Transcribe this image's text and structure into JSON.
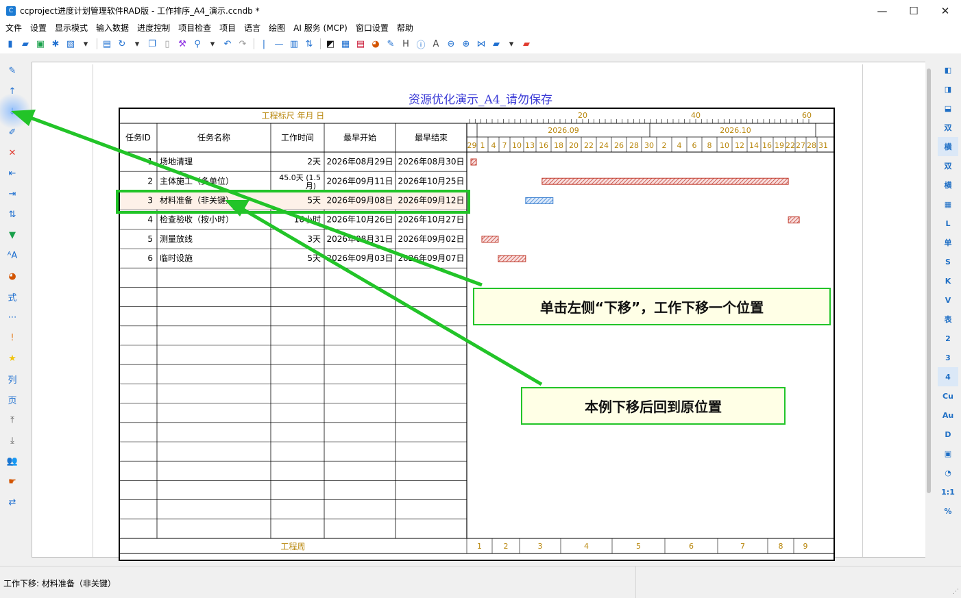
{
  "window": {
    "title": "ccproject进度计划管理软件RAD版 - 工作排序_A4_演示.ccndb *",
    "app_icon": "C",
    "minimize_glyph": "—",
    "maximize_glyph": "☐",
    "close_glyph": "✕"
  },
  "menu": [
    "文件",
    "设置",
    "显示模式",
    "输入数据",
    "进度控制",
    "项目检查",
    "项目",
    "语言",
    "绘图",
    "AI 服务 (MCP)",
    "窗口设置",
    "帮助"
  ],
  "toolbar": [
    {
      "icon": "new-icon",
      "glyph": "▮",
      "color": "#1e6fd0"
    },
    {
      "icon": "open-icon",
      "glyph": "▰",
      "color": "#1e6fd0"
    },
    {
      "icon": "save-icon",
      "glyph": "▣",
      "color": "#18a04a"
    },
    {
      "icon": "asterisk-icon",
      "glyph": "✱",
      "color": "#1e6fd0"
    },
    {
      "icon": "image-icon",
      "glyph": "▧",
      "color": "#1e6fd0"
    },
    {
      "icon": "dropdown-icon",
      "glyph": "▾",
      "color": "#333"
    },
    {
      "icon": "print-icon",
      "glyph": "▤",
      "color": "#1e6fd0"
    },
    {
      "icon": "refresh-icon",
      "glyph": "↻",
      "color": "#1e6fd0"
    },
    {
      "icon": "dropdown-icon",
      "glyph": "▾",
      "color": "#333"
    },
    {
      "icon": "copy-icon",
      "glyph": "❐",
      "color": "#1e6fd0"
    },
    {
      "icon": "paste-icon",
      "glyph": "▯",
      "color": "#999"
    },
    {
      "icon": "format-painter-icon",
      "glyph": "⚒",
      "color": "#8a2be2"
    },
    {
      "icon": "search-icon",
      "glyph": "⚲",
      "color": "#1e6fd0"
    },
    {
      "icon": "dropdown-icon",
      "glyph": "▾",
      "color": "#333"
    },
    {
      "icon": "undo-icon",
      "glyph": "↶",
      "color": "#1e6fd0"
    },
    {
      "icon": "redo-icon",
      "glyph": "↷",
      "color": "#999"
    },
    {
      "icon": "vertical-line-icon",
      "glyph": "|",
      "color": "#1e6fd0"
    },
    {
      "icon": "horizontal-line-icon",
      "glyph": "—",
      "color": "#1e6fd0"
    },
    {
      "icon": "columns-icon",
      "glyph": "▥",
      "color": "#1e6fd0"
    },
    {
      "icon": "sort-icon",
      "glyph": "⇅",
      "color": "#1e6fd0"
    },
    {
      "icon": "network-icon",
      "glyph": "◩",
      "color": "#111"
    },
    {
      "icon": "chart-icon",
      "glyph": "▦",
      "color": "#1e6fd0"
    },
    {
      "icon": "report-icon",
      "glyph": "▤",
      "color": "#c8102e"
    },
    {
      "icon": "palette-icon",
      "glyph": "◕",
      "color": "#d35400"
    },
    {
      "icon": "edit-icon",
      "glyph": "✎",
      "color": "#1e6fd0"
    },
    {
      "icon": "h-icon",
      "glyph": "H",
      "color": "#444"
    },
    {
      "icon": "info-icon",
      "glyph": "ⓘ",
      "color": "#1e6fd0"
    },
    {
      "icon": "font-icon",
      "glyph": "A",
      "color": "#444"
    },
    {
      "icon": "zoom-out-icon",
      "glyph": "⊖",
      "color": "#1e6fd0"
    },
    {
      "icon": "zoom-in-icon",
      "glyph": "⊕",
      "color": "#1e6fd0"
    },
    {
      "icon": "collapse-icon",
      "glyph": "⋈",
      "color": "#1e6fd0"
    },
    {
      "icon": "folder-icon",
      "glyph": "▰",
      "color": "#1e6fd0"
    },
    {
      "icon": "dropdown-icon",
      "glyph": "▾",
      "color": "#333"
    },
    {
      "icon": "briefcase-icon",
      "glyph": "▰",
      "color": "#e03a2f"
    }
  ],
  "left_tools": [
    {
      "icon": "pencil-icon",
      "glyph": "✎",
      "color": "#1e6fd0"
    },
    {
      "icon": "move-up-icon",
      "glyph": "↑",
      "color": "#1e6fd0"
    },
    {
      "icon": "move-down-icon",
      "glyph": "↓",
      "color": "#1e6fd0"
    },
    {
      "icon": "edit-icon",
      "glyph": "✐",
      "color": "#1e6fd0"
    },
    {
      "icon": "delete-icon",
      "glyph": "✕",
      "color": "#e03a2f"
    },
    {
      "icon": "indent-left-icon",
      "glyph": "⇤",
      "color": "#1e6fd0"
    },
    {
      "icon": "indent-right-icon",
      "glyph": "⇥",
      "color": "#1e6fd0"
    },
    {
      "icon": "sort-icon",
      "glyph": "⇅",
      "color": "#1e6fd0"
    },
    {
      "icon": "filter-icon",
      "glyph": "▼",
      "color": "#18a04a"
    },
    {
      "icon": "font-size-icon",
      "glyph": "ᴬA",
      "color": "#1e6fd0"
    },
    {
      "icon": "palette-icon",
      "glyph": "◕",
      "color": "#d35400"
    },
    {
      "icon": "formula-icon",
      "glyph": "式",
      "color": "#1e6fd0"
    },
    {
      "icon": "dots-icon",
      "glyph": "⋯",
      "color": "#1e6fd0"
    },
    {
      "icon": "alert-icon",
      "glyph": "!",
      "color": "#e67e22"
    },
    {
      "icon": "star-icon",
      "glyph": "★",
      "color": "#f1c40f"
    },
    {
      "icon": "column-icon",
      "glyph": "列",
      "color": "#1e6fd0"
    },
    {
      "icon": "page-icon",
      "glyph": "页",
      "color": "#1e6fd0"
    },
    {
      "icon": "upload-icon",
      "glyph": "⤒",
      "color": "#555"
    },
    {
      "icon": "download-icon",
      "glyph": "⤓",
      "color": "#555"
    },
    {
      "icon": "users-icon",
      "glyph": "👥",
      "color": "#18a04a"
    },
    {
      "icon": "hand-icon",
      "glyph": "☛",
      "color": "#d35400"
    },
    {
      "icon": "swap-icon",
      "glyph": "⇄",
      "color": "#1e6fd0"
    }
  ],
  "right_tools": [
    {
      "icon": "panel-left-icon",
      "label": "◧",
      "selected": false
    },
    {
      "icon": "panel-right-icon",
      "label": "◨",
      "selected": false
    },
    {
      "icon": "panel-bottom-icon",
      "label": "⬓",
      "selected": false
    },
    {
      "icon": "double-icon",
      "label": "双",
      "selected": false
    },
    {
      "icon": "horizontal-icon",
      "label": "横",
      "selected": true
    },
    {
      "icon": "double-network-icon",
      "label": "双",
      "selected": false
    },
    {
      "icon": "horizontal-network-icon",
      "label": "横",
      "selected": false
    },
    {
      "icon": "table-icon",
      "label": "▦",
      "selected": false
    },
    {
      "icon": "l-icon",
      "label": "L",
      "selected": false
    },
    {
      "icon": "single-icon",
      "label": "单",
      "selected": false
    },
    {
      "icon": "s-icon",
      "label": "S",
      "selected": false
    },
    {
      "icon": "k-icon",
      "label": "K",
      "selected": false
    },
    {
      "icon": "v-icon",
      "label": "V",
      "selected": false
    },
    {
      "icon": "table-text-icon",
      "label": "表",
      "selected": false
    },
    {
      "icon": "num-2-icon",
      "label": "2",
      "selected": false
    },
    {
      "icon": "num-3-icon",
      "label": "3",
      "selected": false
    },
    {
      "icon": "num-4-icon",
      "label": "4",
      "selected": true
    },
    {
      "icon": "cu-icon",
      "label": "Cu",
      "selected": false
    },
    {
      "icon": "au-icon",
      "label": "Au",
      "selected": false
    },
    {
      "icon": "d-icon",
      "label": "D",
      "selected": false
    },
    {
      "icon": "calendar-icon",
      "label": "▣",
      "selected": false
    },
    {
      "icon": "comment-icon",
      "label": "◔",
      "selected": false
    },
    {
      "icon": "ratio-icon",
      "label": "1:1",
      "selected": false
    },
    {
      "icon": "percent-icon",
      "label": "%",
      "selected": false
    }
  ],
  "document": {
    "title": "资源优化演示_A4_请勿保存",
    "ruler_label": "工程标尺 年月 日",
    "ruler_ticks": [
      "20",
      "40",
      "60"
    ],
    "months": [
      "2026.09",
      "2026.10"
    ],
    "days": [
      "29",
      "1",
      "4",
      "7",
      "10",
      "13",
      "16",
      "18",
      "20",
      "22",
      "24",
      "26",
      "28",
      "30",
      "2",
      "4",
      "6",
      "8",
      "10",
      "12",
      "14",
      "16",
      "19",
      "22",
      "27",
      "28",
      "31"
    ],
    "columns": [
      "任务ID",
      "任务名称",
      "工作时间",
      "最早开始",
      "最早结束"
    ],
    "rows": [
      {
        "id": "1",
        "name": "场地清理",
        "duration": "2天",
        "duration_sub": "",
        "start": "2026年08月29日",
        "end": "2026年08月30日",
        "bar_start": 0,
        "bar_end": 1,
        "critical": true
      },
      {
        "id": "2",
        "name": "主体施工（多单位）",
        "duration": "45.0天 (1.5",
        "duration_sub": "月)",
        "start": "2026年09月11日",
        "end": "2026年10月25日",
        "bar_start": 13,
        "bar_end": 58,
        "critical": true
      },
      {
        "id": "3",
        "name": "材料准备（非关键）",
        "duration": "5天",
        "duration_sub": "",
        "start": "2026年09月08日",
        "end": "2026年09月12日",
        "bar_start": 10,
        "bar_end": 15,
        "critical": false
      },
      {
        "id": "4",
        "name": "检查验收（按小时）",
        "duration": "16小时",
        "duration_sub": "",
        "start": "2026年10月26日",
        "end": "2026年10月27日",
        "bar_start": 58,
        "bar_end": 60,
        "critical": true
      },
      {
        "id": "5",
        "name": "测量放线",
        "duration": "3天",
        "duration_sub": "",
        "start": "2026年08月31日",
        "end": "2026年09月02日",
        "bar_start": 2,
        "bar_end": 5,
        "critical": true
      },
      {
        "id": "6",
        "name": "临时设施",
        "duration": "5天",
        "duration_sub": "",
        "start": "2026年09月03日",
        "end": "2026年09月07日",
        "bar_start": 5,
        "bar_end": 10,
        "critical": true
      }
    ],
    "empty_rows": 14,
    "footer_label": "工程周",
    "weeks": [
      "1",
      "2",
      "3",
      "4",
      "5",
      "6",
      "7",
      "8",
      "9"
    ]
  },
  "annotations": {
    "callout1": "单击左侧“下移”，工作下移一个位置",
    "callout2": "本例下移后回到原位置"
  },
  "status": {
    "text": "工作下移: 材料准备（非关键）"
  },
  "colors": {
    "critical_bar": "#c0392b",
    "noncritical_bar": "#3a7fd0",
    "annotation_green": "#22c428",
    "grid_gold": "#b8860b",
    "title_blue": "#3b3bd6"
  }
}
